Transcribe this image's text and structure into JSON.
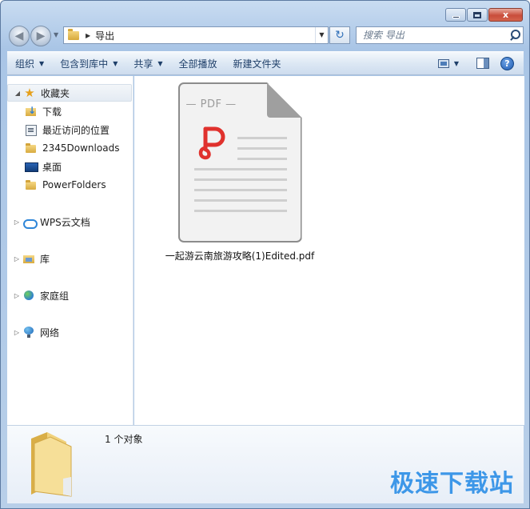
{
  "window": {
    "caption": {
      "minimize_icon": "minimize-icon",
      "maximize_icon": "maximize-icon",
      "close_icon": "close-icon",
      "close_glyph": "x"
    }
  },
  "address_bar": {
    "back_glyph": "◀",
    "forward_glyph": "▶",
    "breadcrumb": [
      "导出"
    ],
    "refresh_icon": "refresh-icon",
    "refresh_glyph": "↻"
  },
  "search": {
    "placeholder": "搜索 导出"
  },
  "commands": {
    "organize": "组织",
    "include_in_library": "包含到库中",
    "share": "共享",
    "play_all": "全部播放",
    "new_folder": "新建文件夹",
    "help_glyph": "?"
  },
  "sidebar": {
    "favorites": {
      "label": "收藏夹",
      "items": [
        {
          "label": "下载",
          "icon": "download-folder-icon"
        },
        {
          "label": "最近访问的位置",
          "icon": "recent-places-icon"
        },
        {
          "label": "2345Downloads",
          "icon": "folder-icon"
        },
        {
          "label": "桌面",
          "icon": "desktop-icon"
        },
        {
          "label": "PowerFolders",
          "icon": "folder-icon"
        }
      ]
    },
    "groups": [
      {
        "label": "WPS云文档",
        "icon": "cloud-icon"
      },
      {
        "label": "库",
        "icon": "library-icon"
      },
      {
        "label": "家庭组",
        "icon": "homegroup-icon"
      },
      {
        "label": "网络",
        "icon": "network-icon"
      }
    ]
  },
  "files": [
    {
      "name": "一起游云南旅游攻略(1)Edited.pdf",
      "type_label": "PDF",
      "icon": "pdf-file-icon"
    }
  ],
  "details": {
    "count_text": "1 个对象",
    "watermark": "极速下载站"
  },
  "colors": {
    "accent": "#1e3f69",
    "pdf_red": "#e0312d",
    "watermark": "#3d97e8"
  }
}
